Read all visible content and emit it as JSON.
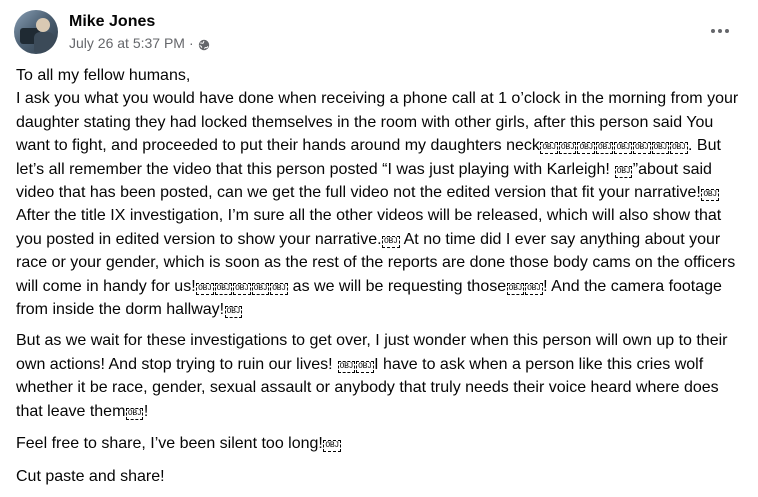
{
  "post": {
    "author": "Mike Jones",
    "timestamp": "July 26 at 5:37 PM",
    "separator": "·",
    "privacy_icon": "globe-icon",
    "more_icon": "more-options-icon",
    "paragraphs": [
      "To all my fellow humans,\nI ask you what you would have done when receiving a phone call at 1 o’clock in the morning from your daughter stating they had locked themselves in the room with other girls, after this person said You want to fight, and proceeded to put their hands around my daughters neck￼￼￼￼￼￼￼￼. But let’s all remember the video that this person posted “I was just playing with Karleigh! ￼”about said video that has been posted, can we get the full video not the edited version that fit your narrative!￼ After the title IX investigation, I’m sure all the other videos will be released, which will also show that you posted in edited version to show your narrative.￼ At no time did I ever say anything about your race or your gender, which is soon as the rest of the reports are done those body cams on the officers will come in handy for us!￼￼￼￼￼ as we will be requesting those￼￼! And the camera footage from inside the dorm hallway!￼",
      "But as we wait for these investigations to get over, I just wonder when this person will own up to their own actions! And stop trying to ruin our lives! ￼￼I have to ask when a person like this cries wolf whether it be race, gender, sexual assault or anybody that truly needs their voice heard where does that leave them￼!",
      "Feel free to share, I’ve been silent too long!￼",
      "Cut paste and share!"
    ]
  }
}
